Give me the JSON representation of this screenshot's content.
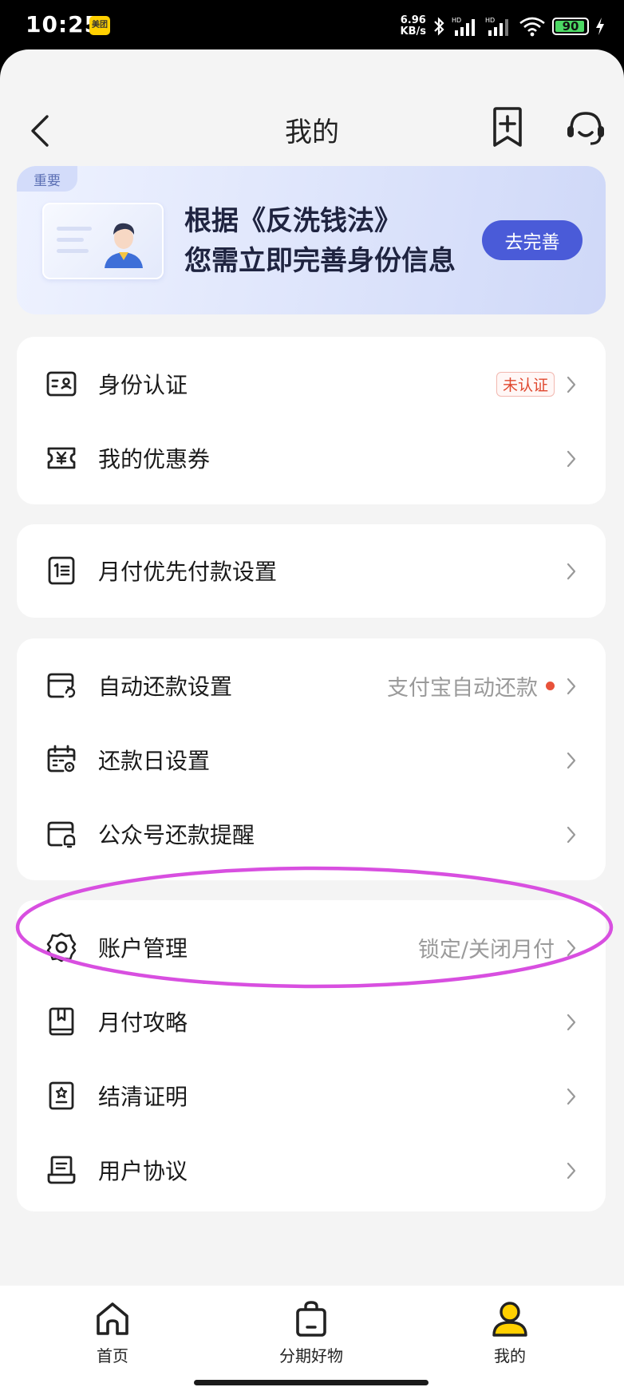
{
  "status_bar": {
    "time": "10:25",
    "app_badge": "美团",
    "net_speed": "6.96",
    "net_unit": "KB/s",
    "battery": "90"
  },
  "nav": {
    "title": "我的"
  },
  "banner": {
    "tag": "重要",
    "line1": "根据《反洗钱法》",
    "line2": "您需立即完善身份信息",
    "button": "去完善"
  },
  "sections": {
    "s1": {
      "identity": {
        "label": "身份认证",
        "badge": "未认证"
      },
      "coupons": {
        "label": "我的优惠券"
      }
    },
    "s2": {
      "priority": {
        "label": "月付优先付款设置"
      }
    },
    "s3": {
      "autopay": {
        "label": "自动还款设置",
        "value": "支付宝自动还款"
      },
      "repay_day": {
        "label": "还款日设置"
      },
      "reminder": {
        "label": "公众号还款提醒"
      }
    },
    "s4": {
      "account": {
        "label": "账户管理",
        "value": "锁定/关闭月付"
      },
      "guide": {
        "label": "月付攻略"
      },
      "cert": {
        "label": "结清证明"
      },
      "agreement": {
        "label": "用户协议"
      }
    }
  },
  "tabbar": {
    "home": "首页",
    "shop": "分期好物",
    "mine": "我的"
  },
  "colors": {
    "accent": "#4a5bd8",
    "active_tab": "#ffd000",
    "highlight": "#d84fe0",
    "warning": "#e0482f"
  }
}
